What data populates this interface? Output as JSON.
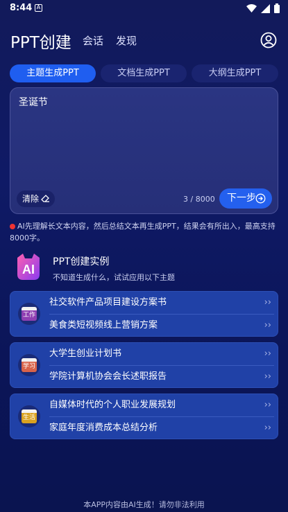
{
  "status": {
    "time": "8:44",
    "notif_glyph": "A"
  },
  "header": {
    "title": "PPT创建",
    "tabs": [
      {
        "label": "会话"
      },
      {
        "label": "发现"
      }
    ],
    "profile_icon": "user-circle-icon"
  },
  "mode_tabs": [
    {
      "label": "主题生成PPT",
      "active": true
    },
    {
      "label": "文档生成PPT",
      "active": false
    },
    {
      "label": "大纲生成PPT",
      "active": false
    }
  ],
  "editor": {
    "value": "圣诞节",
    "clear_label": "清除",
    "counter": "3 / 8000",
    "next_label": "下一步"
  },
  "notice": "AI先理解长文本内容，然后总结文本再生成PPT，结果会有所出入，最高支持8000字。",
  "examples": {
    "logo_text": "AI",
    "title": "PPT创建实例",
    "subtitle": "不知道生成什么，试试应用以下主题",
    "cards": [
      {
        "tag": "工作",
        "tag_color": "#8e3fb2",
        "items": [
          "社交软件产品项目建设方案书",
          "美食类短视频线上营销方案"
        ]
      },
      {
        "tag": "学习",
        "tag_color": "#d8634a",
        "items": [
          "大学生创业计划书",
          "学院计算机协会会长述职报告"
        ]
      },
      {
        "tag": "生活",
        "tag_color": "#d9a21f",
        "items": [
          "自媒体时代的个人职业发展规划",
          "家庭年度消费成本总结分析"
        ]
      }
    ]
  },
  "footer": "本APP内容由AI生成！请勿非法利用",
  "colors": {
    "accent": "#2460ee",
    "background": "#0f1a66",
    "card": "#2041a7"
  }
}
